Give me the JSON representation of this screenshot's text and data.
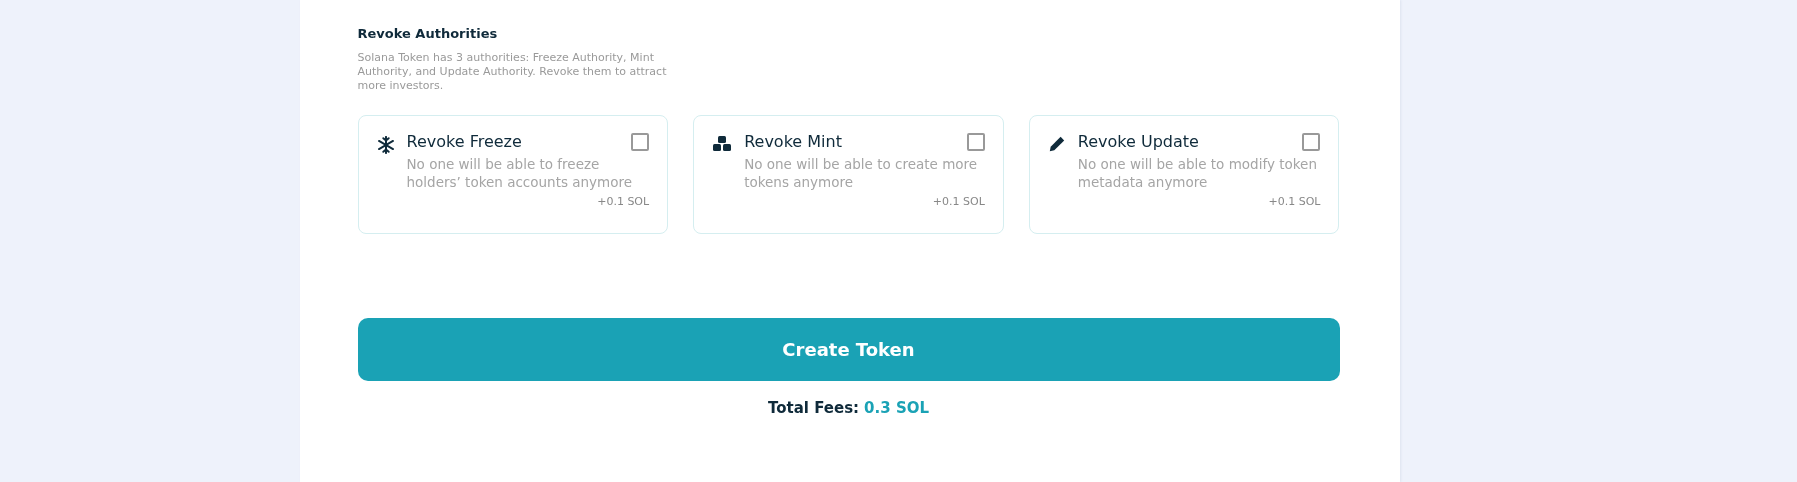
{
  "section": {
    "title": "Revoke Authorities",
    "description": "Solana Token has 3 authorities: Freeze Authority, Mint Authority, and Update Authority. Revoke them to attract more investors."
  },
  "options": [
    {
      "kind": "freeze",
      "title": "Revoke Freeze",
      "description": "No one will be able to freeze holders’ token accounts anymore",
      "fee": "+0.1 SOL",
      "checked": false
    },
    {
      "kind": "mint",
      "title": "Revoke Mint",
      "description": "No one will be able to create more tokens anymore",
      "fee": "+0.1 SOL",
      "checked": false
    },
    {
      "kind": "update",
      "title": "Revoke Update",
      "description": "No one will be able to modify token metadata anymore",
      "fee": "+0.1 SOL",
      "checked": false
    }
  ],
  "submit": {
    "label": "Create Token"
  },
  "total": {
    "label": "Total Fees:",
    "value": "0.3 SOL"
  }
}
